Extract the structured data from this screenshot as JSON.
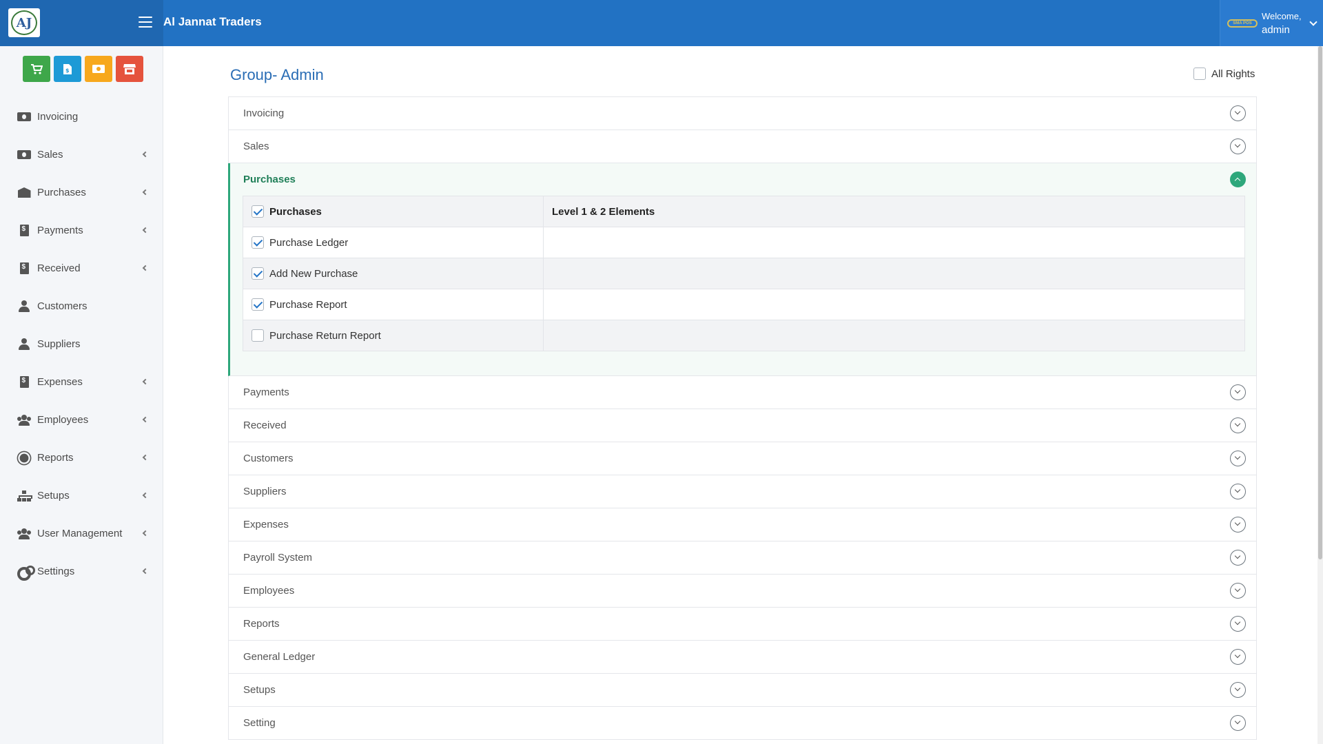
{
  "header": {
    "logo_text": "AJ",
    "app_title": "Al Jannat Traders",
    "pos_badge": "SMA POS",
    "welcome": "Welcome,",
    "username": "admin"
  },
  "sidebar": {
    "quick_actions": [
      {
        "name": "pos",
        "icon": "cart-icon",
        "color": "#3ea74a"
      },
      {
        "name": "invoice",
        "icon": "file-invoice-icon",
        "color": "#1d9ad6"
      },
      {
        "name": "cash",
        "icon": "money-bill-icon",
        "color": "#f7a81d"
      },
      {
        "name": "store",
        "icon": "store-icon",
        "color": "#e5533d"
      }
    ],
    "items": [
      {
        "label": "Invoicing",
        "icon": "money-bill-icon",
        "has_submenu": false
      },
      {
        "label": "Sales",
        "icon": "money-bill-icon",
        "has_submenu": true
      },
      {
        "label": "Purchases",
        "icon": "warehouse-icon",
        "has_submenu": true
      },
      {
        "label": "Payments",
        "icon": "file-invoice-dollar-icon",
        "has_submenu": true
      },
      {
        "label": "Received",
        "icon": "file-invoice-dollar-icon",
        "has_submenu": true
      },
      {
        "label": "Customers",
        "icon": "user-icon",
        "has_submenu": false
      },
      {
        "label": "Suppliers",
        "icon": "user-icon",
        "has_submenu": false
      },
      {
        "label": "Expenses",
        "icon": "file-invoice-dollar-icon",
        "has_submenu": true
      },
      {
        "label": "Employees",
        "icon": "users-cog-icon",
        "has_submenu": true
      },
      {
        "label": "Reports",
        "icon": "gear-icon",
        "has_submenu": true
      },
      {
        "label": "Setups",
        "icon": "sitemap-icon",
        "has_submenu": true
      },
      {
        "label": "User Management",
        "icon": "users-icon",
        "has_submenu": true
      },
      {
        "label": "Settings",
        "icon": "cogs-icon",
        "has_submenu": true
      }
    ]
  },
  "main": {
    "title": "Group- Admin",
    "all_rights_label": "All Rights",
    "all_rights_checked": false,
    "accordion": {
      "before_open": [
        "Invoicing",
        "Sales"
      ],
      "open": {
        "title": "Purchases",
        "header_row": {
          "label": "Purchases",
          "checked": true,
          "col2": "Level 1 & 2 Elements"
        },
        "rows": [
          {
            "label": "Purchase Ledger",
            "checked": true
          },
          {
            "label": "Add New Purchase",
            "checked": true
          },
          {
            "label": "Purchase Report",
            "checked": true
          },
          {
            "label": "Purchase Return Report",
            "checked": false
          }
        ]
      },
      "after_open": [
        "Payments",
        "Received",
        "Customers",
        "Suppliers",
        "Expenses",
        "Payroll System",
        "Employees",
        "Reports",
        "General Ledger",
        "Setups",
        "Setting"
      ]
    }
  },
  "colors": {
    "header_bg": "#2272c3",
    "accent_green": "#2ea77b",
    "title_blue": "#2a6db5"
  }
}
